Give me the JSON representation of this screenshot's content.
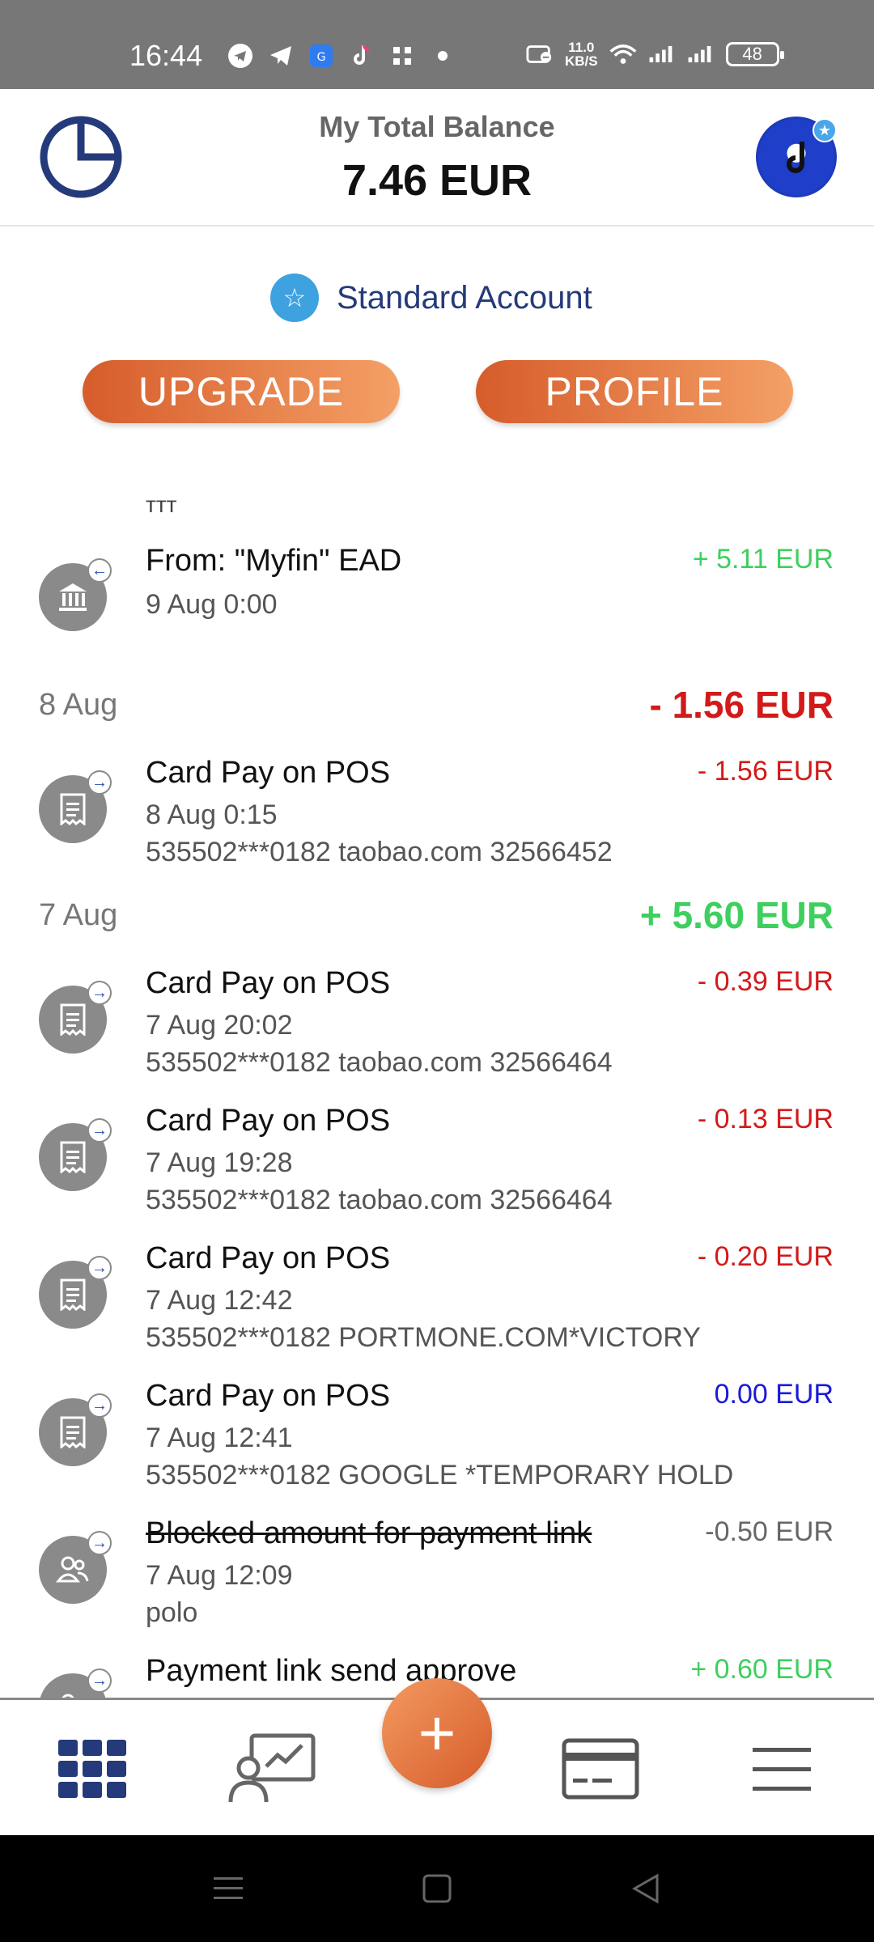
{
  "status_bar": {
    "time": "16:44",
    "net_speed_value": "11.0",
    "net_speed_unit": "KB/S",
    "battery": "48",
    "icons": [
      "telegram-icon",
      "telegram-send-icon",
      "wallet-app-icon",
      "tiktok-icon",
      "grid-app-icon",
      "dot-icon",
      "dnd-icon",
      "wifi-icon",
      "signal-icon",
      "signal-icon-2"
    ]
  },
  "header": {
    "balance_label": "My Total Balance",
    "balance_value": "7.46 EUR",
    "avatar_icon": "avatar-tiktok"
  },
  "account": {
    "label": "Standard Account",
    "icon": "star-icon"
  },
  "buttons": {
    "upgrade": "UPGRADE",
    "profile": "PROFILE"
  },
  "list": {
    "top_label": "ттт",
    "items": [
      {
        "title": "From: \"Myfin\"  EAD",
        "time": "9 Aug 0:00",
        "detail": "",
        "amount": "+ 5.11 EUR",
        "icon": "bank-icon"
      },
      {
        "title": "Card Pay on POS",
        "time": "8 Aug 0:15",
        "detail": "535502***0182 taobao.com 32566452",
        "amount": "- 1.56 EUR",
        "icon": "receipt-icon"
      },
      {
        "title": "Card Pay on POS",
        "time": "7 Aug 20:02",
        "detail": "535502***0182 taobao.com 32566464",
        "amount": "- 0.39 EUR",
        "icon": "receipt-icon"
      },
      {
        "title": "Card Pay on POS",
        "time": "7 Aug 19:28",
        "detail": "535502***0182 taobao.com 32566464",
        "amount": "- 0.13 EUR",
        "icon": "receipt-icon"
      },
      {
        "title": "Card Pay on POS",
        "time": "7 Aug 12:42",
        "detail": "535502***0182 PORTMONE.COM*VICTORY",
        "amount": "- 0.20 EUR",
        "icon": "receipt-icon"
      },
      {
        "title": "Card Pay on POS",
        "time": "7 Aug 12:41",
        "detail": "535502***0182 GOOGLE *TEMPORARY HOLD",
        "amount": "0.00 EUR",
        "icon": "receipt-icon"
      },
      {
        "title": "Blocked amount for payment link",
        "time": "7 Aug 12:09",
        "detail": "polo",
        "amount": "-0.50 EUR",
        "icon": "users-icon"
      },
      {
        "title": "Payment link send approve",
        "time": "",
        "detail": "",
        "amount": "+ 0.60 EUR",
        "icon": "users-icon"
      }
    ],
    "days": [
      {
        "label": "8 Aug",
        "total": "- 1.56 EUR"
      },
      {
        "label": "7 Aug",
        "total": "+ 5.60 EUR"
      }
    ]
  },
  "bottom_nav": {
    "items": [
      "dashboard-grid-icon",
      "investment-icon",
      "add-icon",
      "card-icon",
      "menu-icon"
    ],
    "fab_label": "+"
  },
  "colors": {
    "accent_start": "#d65c2b",
    "accent_end": "#f4a066",
    "positive": "#3fcf5f",
    "negative": "#d21a1a",
    "neutral": "#1a1ad9",
    "nav_blue": "#253a7a"
  }
}
